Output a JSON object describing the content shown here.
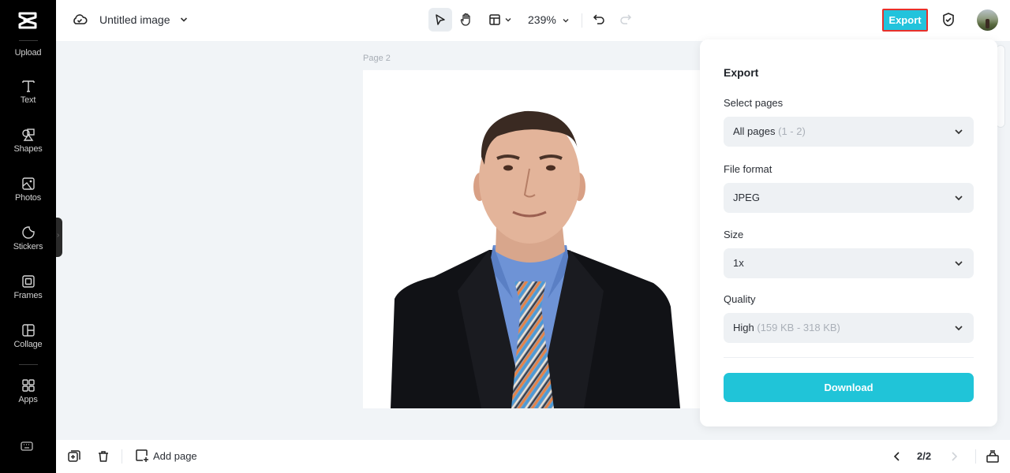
{
  "app": {
    "document_title": "Untitled image",
    "zoom_level": "239%"
  },
  "sidebar": {
    "items": [
      {
        "id": "upload",
        "label": "Upload",
        "icon": "upload-icon"
      },
      {
        "id": "text",
        "label": "Text",
        "icon": "text-icon"
      },
      {
        "id": "shapes",
        "label": "Shapes",
        "icon": "shapes-icon"
      },
      {
        "id": "photos",
        "label": "Photos",
        "icon": "photo-icon"
      },
      {
        "id": "stickers",
        "label": "Stickers",
        "icon": "sticker-icon"
      },
      {
        "id": "frames",
        "label": "Frames",
        "icon": "frame-icon"
      },
      {
        "id": "collage",
        "label": "Collage",
        "icon": "collage-icon"
      },
      {
        "id": "apps",
        "label": "Apps",
        "icon": "apps-icon"
      }
    ]
  },
  "toolbar": {
    "export_label": "Export"
  },
  "canvas": {
    "page_label": "Page 2",
    "image_description": "Portrait of a man in a dark suit, blue shirt and striped tie on white background"
  },
  "bottombar": {
    "add_page_label": "Add page",
    "page_indicator": "2/2"
  },
  "export_panel": {
    "title": "Export",
    "fields": [
      {
        "label": "Select pages",
        "value": "All pages",
        "hint": "(1 - 2)"
      },
      {
        "label": "File format",
        "value": "JPEG",
        "hint": ""
      },
      {
        "label": "Size",
        "value": "1x",
        "hint": ""
      },
      {
        "label": "Quality",
        "value": "High",
        "hint": "(159 KB - 318 KB)"
      }
    ],
    "download_label": "Download"
  },
  "colors": {
    "accent": "#22c3dc",
    "download_button": "#20c4d8",
    "export_highlight_border": "#e8302a",
    "sidebar_bg": "#000000",
    "canvas_bg": "#f1f4f7"
  }
}
